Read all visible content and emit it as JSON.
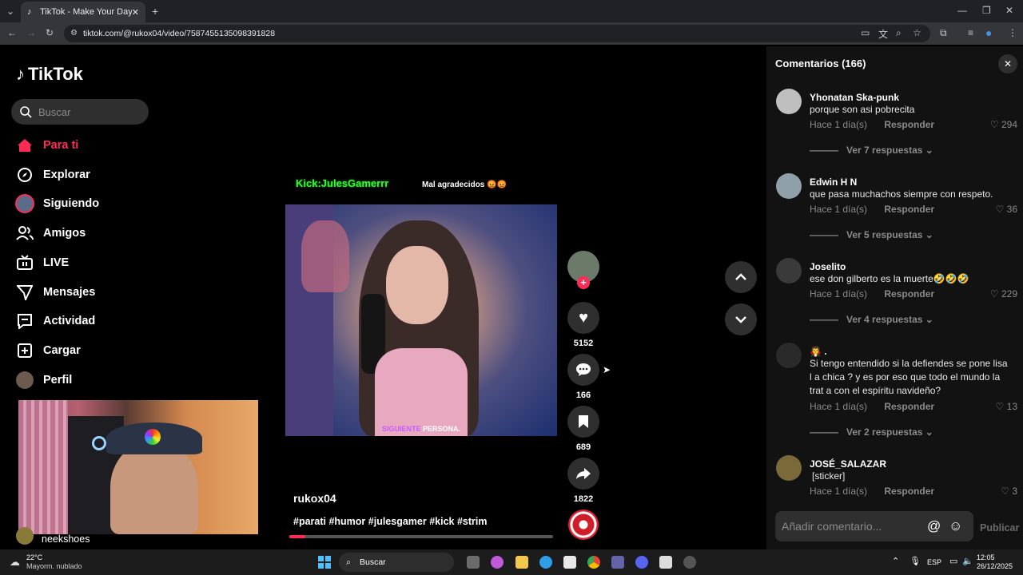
{
  "browser": {
    "tab_title": "TikTok - Make Your Day",
    "url": "tiktok.com/@rukox04/video/7587455135098391828"
  },
  "sidebar": {
    "logo": "TikTok",
    "search_placeholder": "Buscar",
    "items": [
      {
        "label": "Para ti",
        "icon": "home-icon"
      },
      {
        "label": "Explorar",
        "icon": "compass-icon"
      },
      {
        "label": "Siguiendo",
        "icon": "following-avatar-icon"
      },
      {
        "label": "Amigos",
        "icon": "friends-icon"
      },
      {
        "label": "LIVE",
        "icon": "live-icon"
      },
      {
        "label": "Mensajes",
        "icon": "messages-icon"
      },
      {
        "label": "Actividad",
        "icon": "activity-icon"
      },
      {
        "label": "Cargar",
        "icon": "upload-icon"
      },
      {
        "label": "Perfil",
        "icon": "profile-avatar-icon"
      }
    ],
    "bottom_user": "neekshoes"
  },
  "video": {
    "overlay_left": "Kick:JulesGamerrr",
    "overlay_right": "Mal agradecidos 😡😡",
    "subtitle_a": "SIGUIENTE",
    "subtitle_b": "PERSONA.",
    "author": "rukox04",
    "hashtags": "#parati #humor #julesgamer #kick #strim"
  },
  "actions": {
    "likes": "5152",
    "comments": "166",
    "saves": "689",
    "shares": "1822"
  },
  "comments_panel": {
    "title": "Comentarios (166)",
    "reply_label": "Responder",
    "input_placeholder": "Añadir comentario...",
    "publish": "Publicar",
    "comments": [
      {
        "user": "Yhonatan Ska-punk",
        "text": "porque son asi pobrecita",
        "time": "Hace 1 día(s)",
        "likes": "294",
        "more": "Ver 7 respuestas"
      },
      {
        "user": "Edwin H N",
        "text": "que pasa muchachos siempre con respeto.",
        "time": "Hace 1 día(s)",
        "likes": "36",
        "more": "Ver 5 respuestas"
      },
      {
        "user": "Joselito",
        "text": "ese don gilberto es la muerte🤣🤣🤣",
        "time": "Hace 1 día(s)",
        "likes": "229",
        "more": "Ver 4 respuestas"
      },
      {
        "user": "🧛 .",
        "text": "Si tengo entendido si la defiendes se pone lisa l a chica ? y es por eso que todo el mundo la trat a con el espíritu navideño?",
        "time": "Hace 1 día(s)",
        "likes": "13",
        "more": "Ver 2 respuestas"
      },
      {
        "user": "JOSÉ_SALAZAR",
        "text": "[sticker]",
        "time": "Hace 1 día(s)",
        "likes": "3",
        "more": ""
      }
    ]
  },
  "taskbar": {
    "weather_temp": "22°C",
    "weather_desc": "Mayorm. nublado",
    "search": "Buscar",
    "lang": "ESP",
    "time": "12:05",
    "date": "26/12/2025"
  }
}
